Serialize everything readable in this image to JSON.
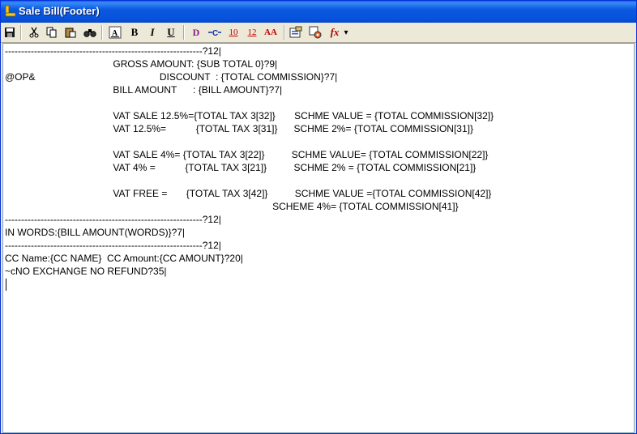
{
  "window": {
    "title": "Sale Bill(Footer)"
  },
  "toolbar": {
    "bold": "B",
    "italic": "I",
    "underline": "U",
    "d_label": "D",
    "h10": "10",
    "h12": "12",
    "aa": "AA",
    "fx": "fx",
    "dd": "▾"
  },
  "editor": {
    "lines": [
      "-------------------------------------------------------------?12|",
      "                                        GROSS AMOUNT: {SUB TOTAL 0}?9|",
      "@OP&                                              DISCOUNT  : {TOTAL COMMISSION}?7|",
      "                                        BILL AMOUNT      : {BILL AMOUNT}?7|",
      "",
      "                                        VAT SALE 12.5%={TOTAL TAX 3[32]}       SCHME VALUE = {TOTAL COMMISSION[32]}",
      "                                        VAT 12.5%=           {TOTAL TAX 3[31]}      SCHME 2%= {TOTAL COMMISSION[31]}",
      "",
      "                                        VAT SALE 4%= {TOTAL TAX 3[22]}          SCHME VALUE= {TOTAL COMMISSION[22]}",
      "                                        VAT 4% =           {TOTAL TAX 3[21]}          SCHME 2% = {TOTAL COMMISSION[21]}",
      "",
      "                                        VAT FREE =       {TOTAL TAX 3[42]}          SCHME VALUE ={TOTAL COMMISSION[42]}",
      "                                                                                                   SCHEME 4%= {TOTAL COMMISSION[41]}",
      "-------------------------------------------------------------?12|",
      "IN WORDS:{BILL AMOUNT(WORDS)}?7|",
      "-------------------------------------------------------------?12|",
      "CC Name:{CC NAME}  CC Amount:{CC AMOUNT}?20|",
      "~cNO EXCHANGE NO REFUND?35|"
    ]
  }
}
